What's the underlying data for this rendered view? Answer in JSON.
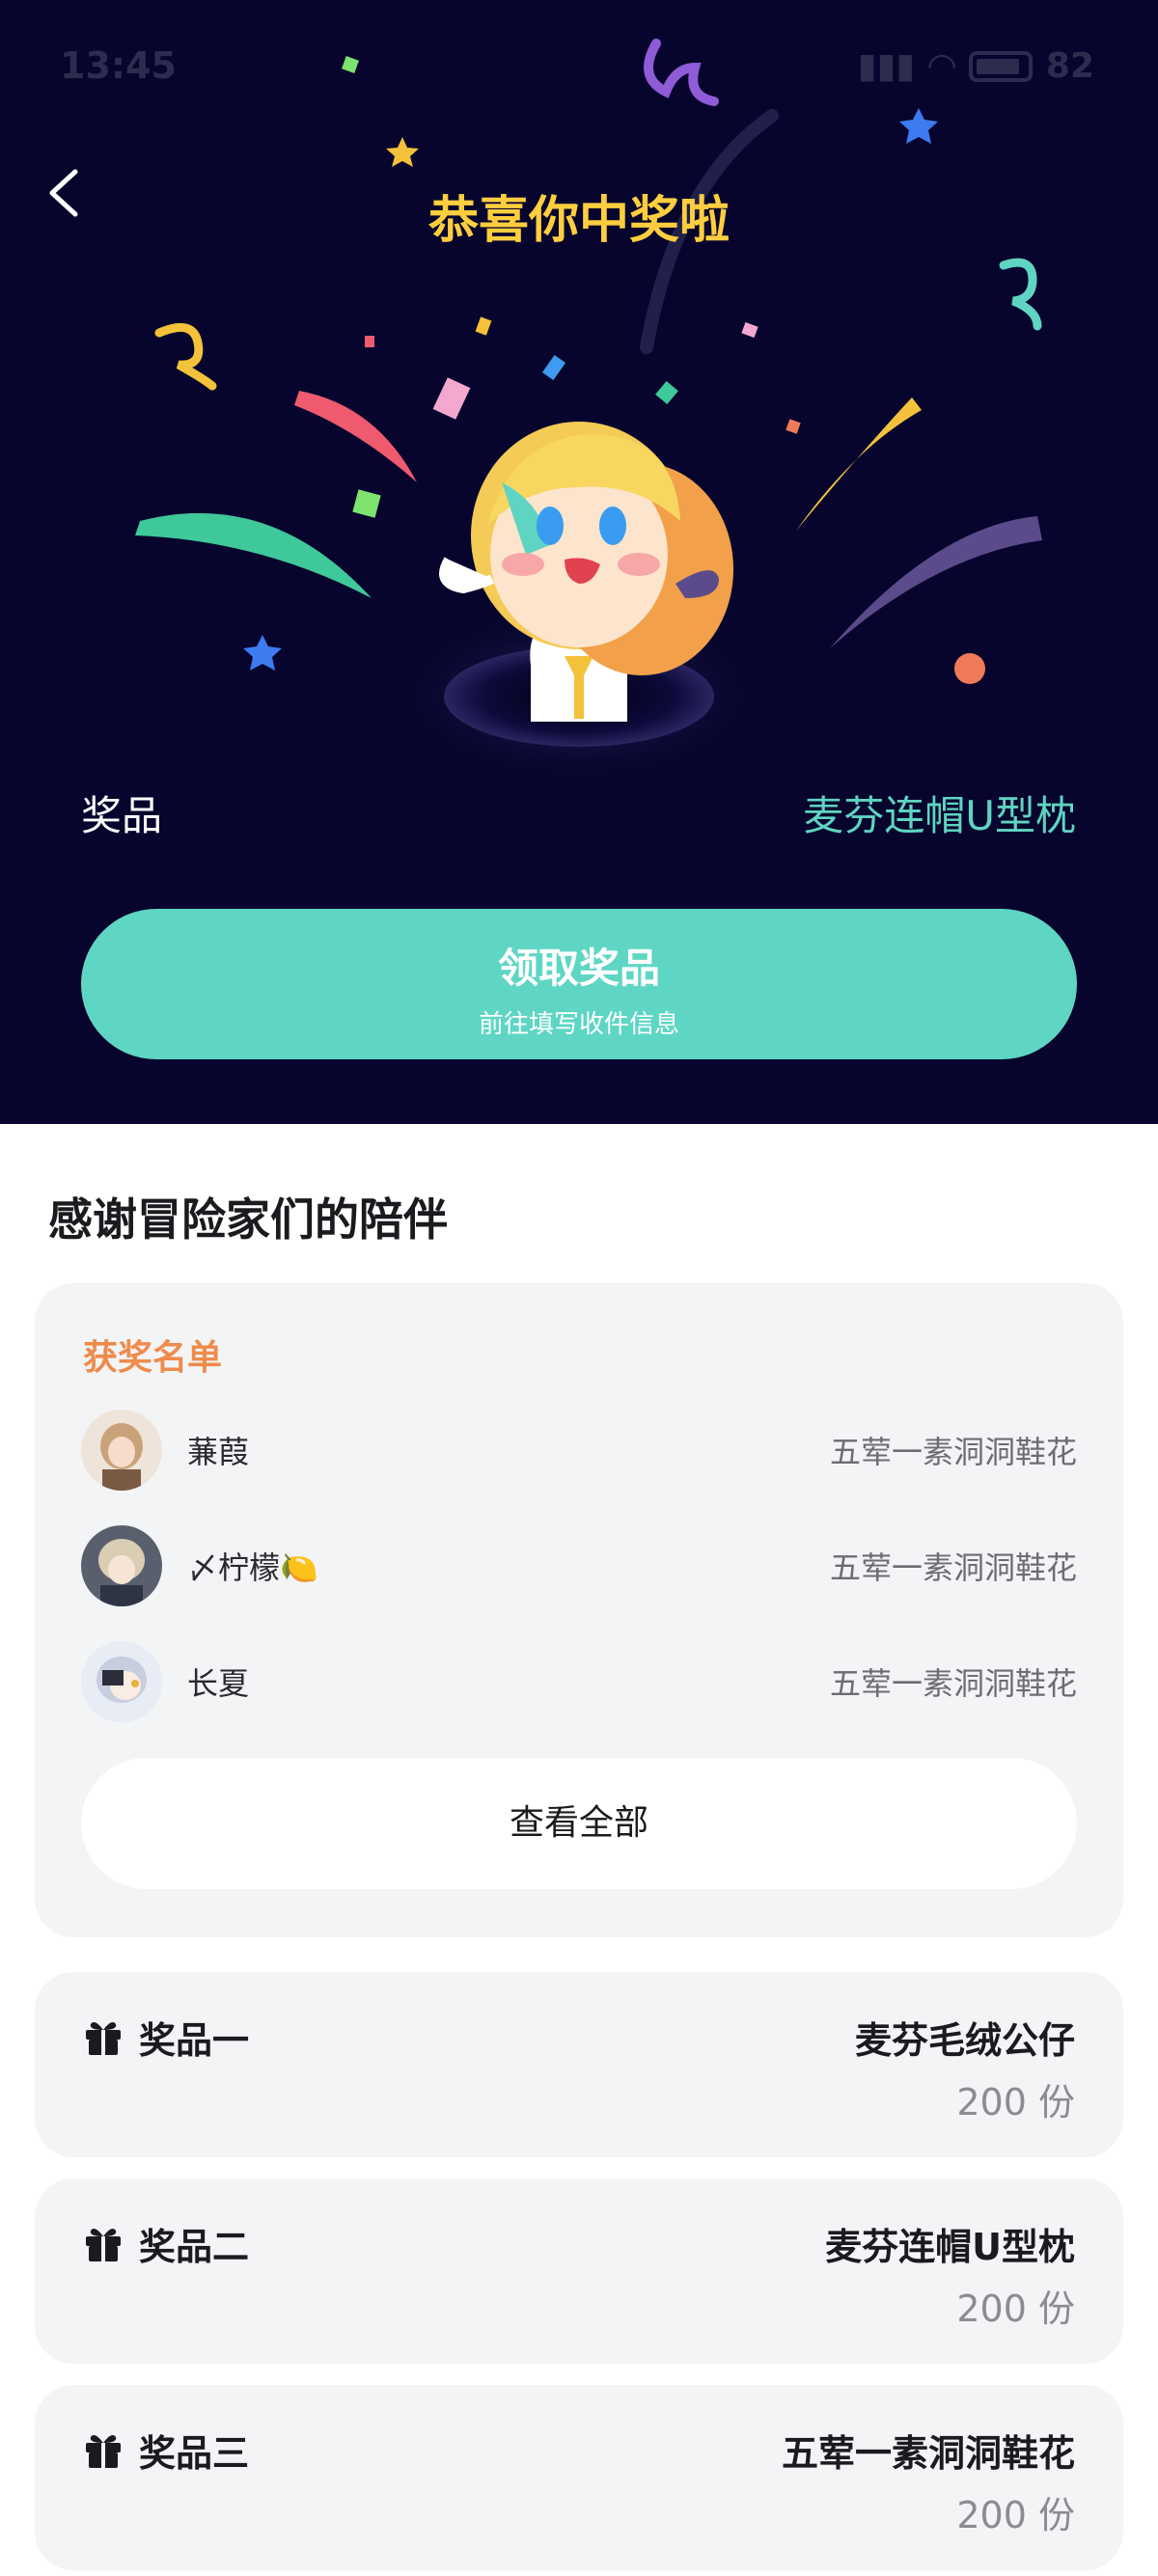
{
  "status_bar": {
    "time": "13:45",
    "battery": "82"
  },
  "hero": {
    "title": "恭喜你中奖啦",
    "prize_label": "奖品",
    "prize_value": "麦芬连帽U型枕",
    "claim_button": {
      "label": "领取奖品",
      "sublabel": "前往填写收件信息"
    }
  },
  "section": {
    "title": "感谢冒险家们的陪伴"
  },
  "winners": {
    "heading": "获奖名单",
    "rows": [
      {
        "name": "蒹葭",
        "prize": "五荤一素洞洞鞋花"
      },
      {
        "name": "〆柠檬🍋",
        "prize": "五荤一素洞洞鞋花"
      },
      {
        "name": "长夏",
        "prize": "五荤一素洞洞鞋花"
      }
    ],
    "view_all": "查看全部"
  },
  "prizes": [
    {
      "tier": "奖品一",
      "item": "麦芬毛绒公仔",
      "count": "200 份"
    },
    {
      "tier": "奖品二",
      "item": "麦芬连帽U型枕",
      "count": "200 份"
    },
    {
      "tier": "奖品三",
      "item": "五荤一素洞洞鞋花",
      "count": "200 份"
    }
  ],
  "colors": {
    "hero_bg": "#07052d",
    "title_gold": "#ffce3f",
    "accent_teal": "#5fd6c4",
    "heading_orange": "#ef8b4b"
  }
}
